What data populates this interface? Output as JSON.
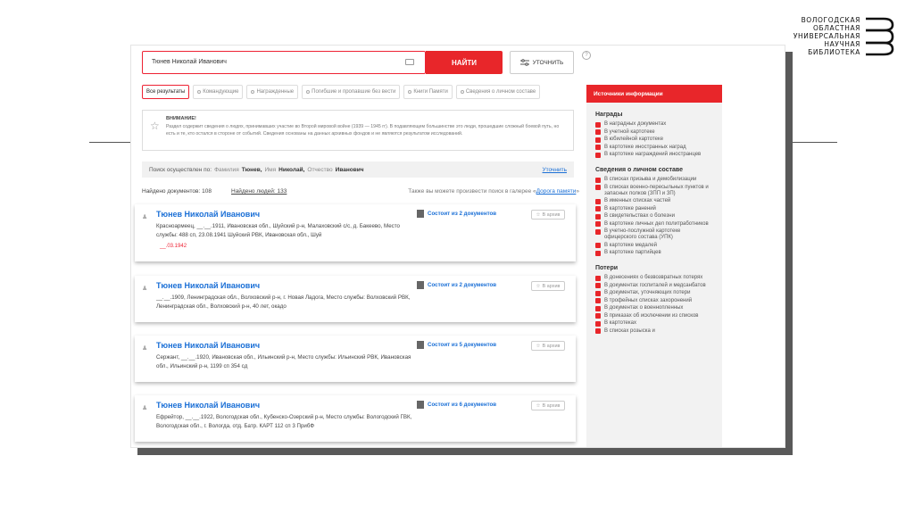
{
  "logo": {
    "lines": [
      "ВОЛОГОДСКАЯ",
      "ОБЛАСТНАЯ",
      "УНИВЕРСАЛЬНАЯ",
      "НАУЧНАЯ",
      "БИБЛИОТЕКА"
    ]
  },
  "search": {
    "value": "Тюнев Николай Иванович",
    "find_label": "НАЙТИ",
    "refine_label": "УТОЧНИТЬ",
    "help": "?"
  },
  "tabs": [
    "Все результаты",
    "Командующие",
    "Награжденные",
    "Погибшие и пропавшие без вести",
    "Книги Памяти",
    "Сведения о личном составе"
  ],
  "notice": {
    "title": "ВНИМАНИЕ!",
    "text": "Раздел содержит сведения о людях, принимавших участие во Второй мировой войне (1939 — 1945 гг). В подавляющем большинстве это люди, прошедшие сложный боевой путь, но есть и те, кто остался в стороне от событий. Сведения основаны на данных архивных фондов и не являются результатом исследований."
  },
  "criteria": {
    "prefix": "Поиск осуществлен по:",
    "surname_label": "Фамилия",
    "surname": "Тюнев,",
    "name_label": "Имя",
    "name": "Николай,",
    "patronymic_label": "Отчество",
    "patronymic": "Иванович",
    "refine_link": "Уточнить"
  },
  "counts": {
    "documents": "Найдено документов: 108",
    "people": "Найдено людей: 133",
    "also_prefix": "Также вы можете произвести поиск в галерее «",
    "also_link": "Дорога памяти",
    "also_suffix": "»"
  },
  "results": [
    {
      "name": "Тюнев Николай Иванович",
      "info": "Красноармеец, __.__.1911, Ивановская обл., Шуйский р-н, Малаховский с/с, д. Бакеево, Место службы: 488 сп, 23.08.1941 Шуйский РВК, Ивановская обл., Шуй",
      "date": "__.03.1942",
      "docs": "Состоит из 2 документов",
      "fav": "В архив"
    },
    {
      "name": "Тюнев Николай Иванович",
      "info": "__.__.1909, Ленинградская обл., Волховский р-н, г. Новая Ладога, Место службы: Волховский РВК, Ленинградская обл., Волховский р-н, 40 лет, окадо",
      "date": "",
      "docs": "Состоит из 2 документов",
      "fav": "В архив"
    },
    {
      "name": "Тюнев Николай Иванович",
      "info": "Сержант, __.__.1920, Ивановская обл., Ильинский р-н, Место службы: Ильинский РВК, Ивановская обл., Ильинский р-н, 1199 сп 354 сд",
      "date": "",
      "docs": "Состоит из 5 документов",
      "fav": "В архив"
    },
    {
      "name": "Тюнев Николай Иванович",
      "info": "Ефрейтор, __.__.1922, Вологодская обл., Кубенско-Озерский р-н, Место службы: Вологодский ГВК, Вологодская обл., г. Вологда, отд. Батр. КАРТ 112 сп 3 ПрибФ",
      "date": "",
      "docs": "Состоит из 6 документов",
      "fav": "В архив"
    }
  ],
  "sidebar": {
    "header": "Источники информации",
    "groups": [
      {
        "title": "Награды",
        "items": [
          "В наградных документах",
          "В учетной картотеке",
          "В юбилейной картотеке",
          "В картотеке иностранных наград",
          "В картотеке награждений иностранцев"
        ]
      },
      {
        "title": "Сведения о личном составе",
        "items": [
          "В списках призыва и демобилизации",
          "В списках военно-пересыльных пунктов и запасных полков (ЗПП и ЗП)",
          "В именных списках частей",
          "В картотеке ранений",
          "В свидетельствах о болезни",
          "В картотеке личных дел политработников",
          "В учетно-послужной картотеке офицерского состава (УПК)",
          "В картотеке медалей",
          "В картотеке партийцев"
        ]
      },
      {
        "title": "Потери",
        "items": [
          "В донесениях о безвозвратных потерях",
          "В документах госпиталей и медсанбатов",
          "В документах, уточняющих потери",
          "В трофейных списках захоронений",
          "В документах о военнопленных",
          "В приказах об исключении из списков",
          "В картотеках",
          "В списках розыска и"
        ]
      }
    ]
  },
  "colors": {
    "accent": "#e8262a",
    "link": "#1a6fd6"
  }
}
